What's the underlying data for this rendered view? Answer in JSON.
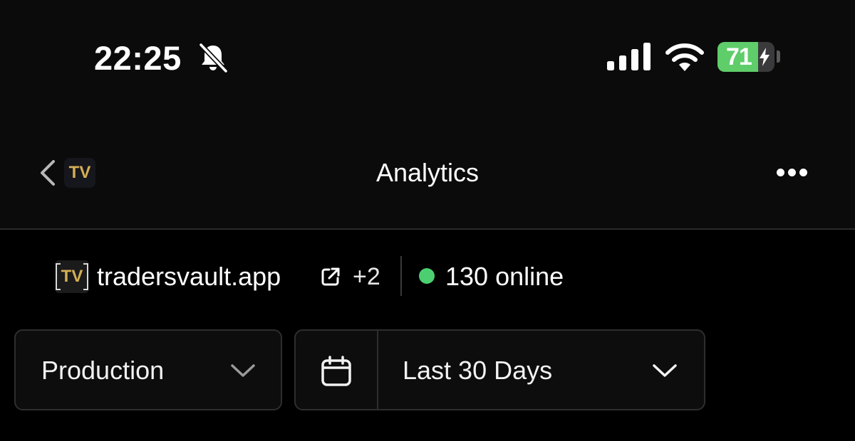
{
  "status_bar": {
    "time": "22:25",
    "battery_percent": 71,
    "battery_label": "71",
    "icons": [
      "bell-slash-icon",
      "cellular-signal-icon",
      "wifi-icon",
      "battery-charging-icon"
    ]
  },
  "nav": {
    "logo_text": "TV",
    "title": "Analytics",
    "icons": [
      "chevron-left-icon",
      "more-horizontal-icon"
    ]
  },
  "site": {
    "logo_text": "TV",
    "name": "tradersvault.app",
    "extra_count": "+2",
    "online": "130 online",
    "icons": [
      "external-link-icon",
      "online-status-dot"
    ]
  },
  "filters": {
    "environment": "Production",
    "date_range": "Last 30 Days",
    "icons": [
      "chevron-down-icon",
      "calendar-icon"
    ]
  },
  "colors": {
    "background": "#000000",
    "header_background": "#0b0b0b",
    "brand_gold": "#d4ae56",
    "online_green": "#4ccf70",
    "battery_green": "#5fcd6a",
    "border": "#2e2e2e"
  }
}
